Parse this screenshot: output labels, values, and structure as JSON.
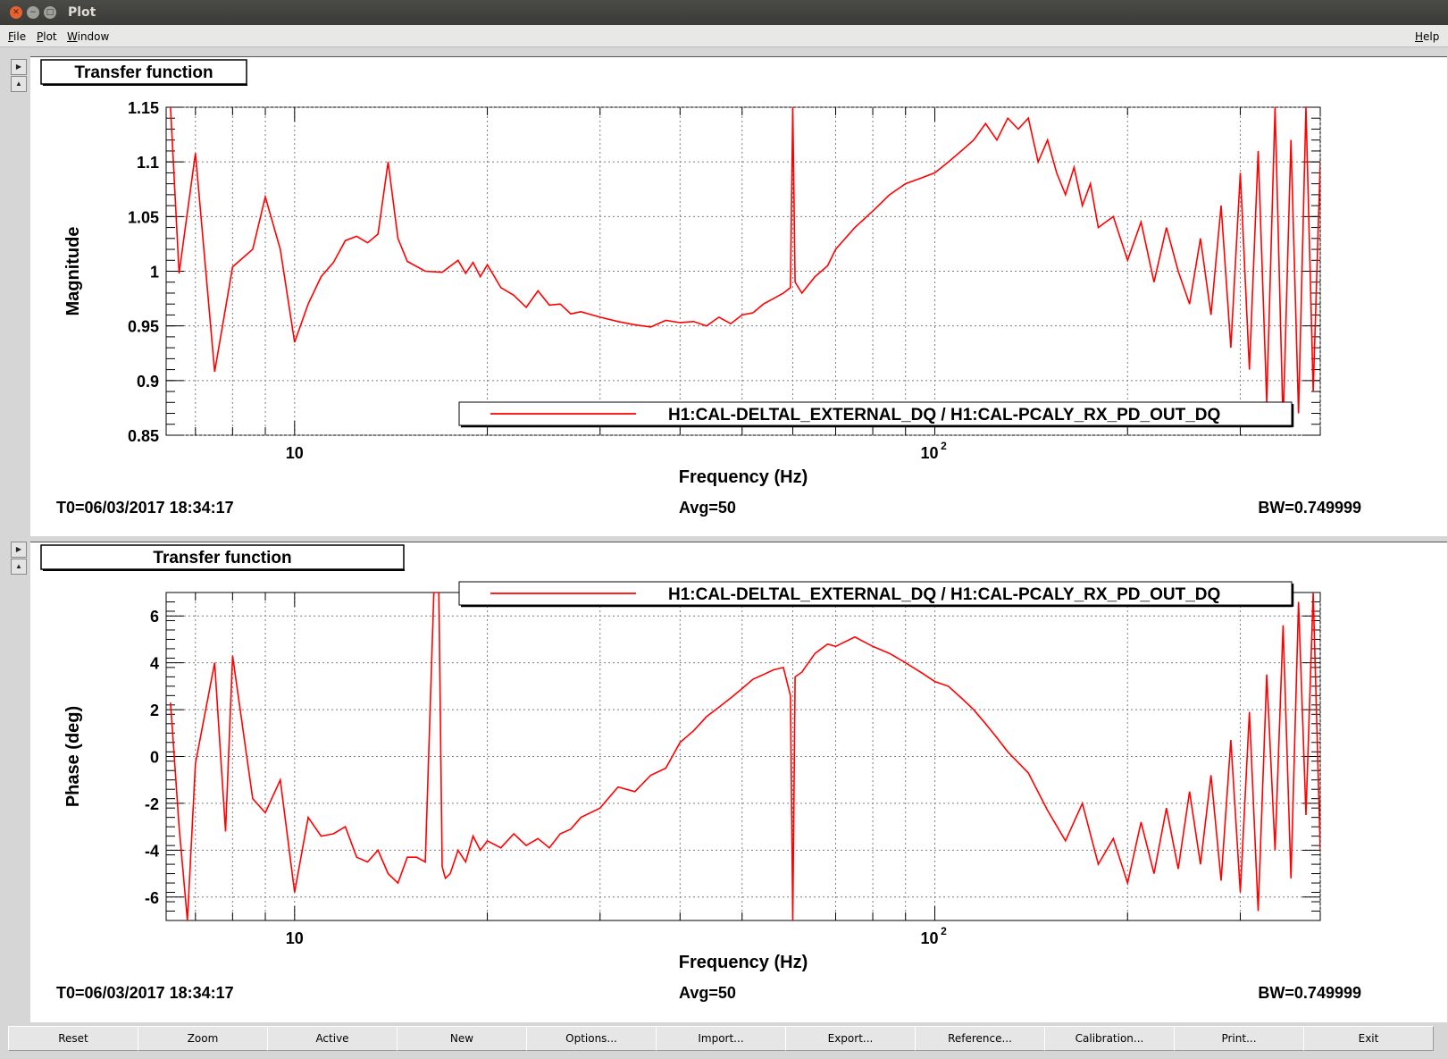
{
  "window": {
    "title": "Plot"
  },
  "menu": {
    "file": "File",
    "plot": "Plot",
    "window": "Window",
    "help": "Help"
  },
  "buttons": [
    "Reset",
    "Zoom",
    "Active",
    "New",
    "Options...",
    "Import...",
    "Export...",
    "Reference...",
    "Calibration...",
    "Print...",
    "Exit"
  ],
  "colors": {
    "trace": "#ff0000",
    "background": "#ffffff",
    "grid": "#7f7f7f"
  },
  "chart_data": [
    {
      "type": "line",
      "title": "Transfer function",
      "xlabel": "Frequency (Hz)",
      "ylabel": "Magnitude",
      "xscale": "log",
      "xlim": [
        6.3,
        400
      ],
      "ylim": [
        0.85,
        1.15
      ],
      "grid": true,
      "legend_position": "bottom-right",
      "x_tick_labels": [
        "10",
        "10",
        "2"
      ],
      "y_tick_labels": [
        "0.85",
        "0.9",
        "0.95",
        "1",
        "1.05",
        "1.1",
        "1.15"
      ],
      "footer": {
        "t0": "T0=06/03/2017 18:34:17",
        "avg": "Avg=50",
        "bw": "BW=0.749999"
      },
      "series": [
        {
          "name": "H1:CAL-DELTAL_EXTERNAL_DQ / H1:CAL-PCALY_RX_PD_OUT_DQ",
          "x": [
            6.4,
            6.6,
            7,
            7.5,
            8,
            8.6,
            9,
            9.5,
            10,
            10.5,
            11,
            11.5,
            12,
            12.5,
            13,
            13.5,
            14,
            14.5,
            15,
            16,
            17,
            18,
            18.5,
            19,
            19.5,
            20,
            21,
            22,
            23,
            24,
            25,
            26,
            27,
            28,
            30,
            32,
            34,
            36,
            38,
            40,
            42,
            44,
            46,
            48,
            50,
            52,
            54,
            56,
            58,
            59.5,
            60,
            60.5,
            62,
            65,
            68,
            70,
            75,
            80,
            85,
            90,
            95,
            100,
            105,
            110,
            115,
            120,
            125,
            130,
            135,
            140,
            145,
            150,
            155,
            160,
            165,
            170,
            175,
            180,
            190,
            200,
            210,
            220,
            230,
            240,
            250,
            260,
            270,
            280,
            290,
            300,
            310,
            320,
            330,
            340,
            350,
            360,
            370,
            380,
            390,
            400
          ],
          "y": [
            1.15,
            0.998,
            1.108,
            0.908,
            1.004,
            1.02,
            1.068,
            1.02,
            0.935,
            0.97,
            0.995,
            1.008,
            1.028,
            1.032,
            1.026,
            1.034,
            1.1,
            1.03,
            1.009,
            1.0,
            0.999,
            1.01,
            0.998,
            1.008,
            0.995,
            1.006,
            0.985,
            0.978,
            0.967,
            0.982,
            0.969,
            0.97,
            0.961,
            0.963,
            0.958,
            0.954,
            0.951,
            0.949,
            0.955,
            0.953,
            0.954,
            0.95,
            0.958,
            0.952,
            0.96,
            0.962,
            0.97,
            0.975,
            0.98,
            0.985,
            1.15,
            0.99,
            0.98,
            0.995,
            1.005,
            1.02,
            1.04,
            1.055,
            1.07,
            1.08,
            1.085,
            1.09,
            1.1,
            1.11,
            1.12,
            1.135,
            1.12,
            1.14,
            1.13,
            1.14,
            1.1,
            1.12,
            1.09,
            1.07,
            1.095,
            1.06,
            1.08,
            1.04,
            1.05,
            1.01,
            1.045,
            0.99,
            1.04,
            1.0,
            0.97,
            1.03,
            0.96,
            1.06,
            0.93,
            1.09,
            0.91,
            1.11,
            0.88,
            1.15,
            0.86,
            1.12,
            0.87,
            1.15,
            0.89,
            1.1
          ]
        }
      ]
    },
    {
      "type": "line",
      "title": "Transfer function",
      "xlabel": "Frequency (Hz)",
      "ylabel": "Phase (deg)",
      "xscale": "log",
      "xlim": [
        6.3,
        400
      ],
      "ylim": [
        -7,
        7
      ],
      "grid": true,
      "legend_position": "top-right",
      "x_tick_labels": [
        "10",
        "10",
        "2"
      ],
      "y_tick_labels": [
        "-6",
        "-4",
        "-2",
        "0",
        "2",
        "4",
        "6"
      ],
      "footer": {
        "t0": "T0=06/03/2017 18:34:17",
        "avg": "Avg=50",
        "bw": "BW=0.749999"
      },
      "series": [
        {
          "name": "H1:CAL-DELTAL_EXTERNAL_DQ / H1:CAL-PCALY_RX_PD_OUT_DQ",
          "x": [
            6.4,
            6.6,
            6.8,
            7,
            7.5,
            7.8,
            8,
            8.6,
            9,
            9.5,
            10,
            10.5,
            11,
            11.5,
            12,
            12.5,
            13,
            13.5,
            14,
            14.5,
            15,
            15.5,
            16,
            16.5,
            16.8,
            17,
            17.2,
            17.5,
            18,
            18.5,
            19,
            19.5,
            20,
            21,
            22,
            23,
            24,
            25,
            26,
            27,
            28,
            30,
            32,
            34,
            36,
            38,
            40,
            42,
            44,
            46,
            48,
            50,
            52,
            54,
            56,
            58,
            59.5,
            60,
            60.5,
            62,
            65,
            68,
            70,
            75,
            80,
            85,
            90,
            95,
            100,
            105,
            110,
            115,
            120,
            125,
            130,
            140,
            150,
            160,
            170,
            180,
            190,
            200,
            210,
            220,
            230,
            240,
            250,
            260,
            270,
            280,
            290,
            300,
            310,
            320,
            330,
            340,
            350,
            360,
            370,
            380,
            390,
            400
          ],
          "y": [
            2.3,
            -3,
            -7,
            -0.3,
            4,
            -3.2,
            4.3,
            -1.8,
            -2.4,
            -1.0,
            -5.8,
            -2.6,
            -3.4,
            -3.3,
            -3.0,
            -4.3,
            -4.5,
            -4.0,
            -5.0,
            -5.4,
            -4.3,
            -4.3,
            -4.5,
            7,
            7,
            -4.7,
            -5.2,
            -5.0,
            -4.0,
            -4.5,
            -3.4,
            -4.0,
            -3.6,
            -3.9,
            -3.3,
            -3.8,
            -3.5,
            -3.9,
            -3.3,
            -3.1,
            -2.6,
            -2.2,
            -1.3,
            -1.5,
            -0.8,
            -0.5,
            0.6,
            1.1,
            1.7,
            2.1,
            2.5,
            2.9,
            3.3,
            3.5,
            3.7,
            3.8,
            2.6,
            -7,
            3.4,
            3.6,
            4.4,
            4.8,
            4.7,
            5.1,
            4.7,
            4.4,
            4.0,
            3.6,
            3.2,
            3.0,
            2.5,
            2.0,
            1.4,
            0.8,
            0.2,
            -0.7,
            -2.3,
            -3.6,
            -2.0,
            -4.6,
            -3.5,
            -5.4,
            -2.8,
            -5.0,
            -2.2,
            -4.8,
            -1.5,
            -4.6,
            -0.8,
            -5.3,
            0.7,
            -5.8,
            1.9,
            -6.6,
            3.5,
            -4.0,
            5.6,
            -5.2,
            6.6,
            -2.5,
            7.0,
            -4.0
          ]
        }
      ]
    }
  ]
}
